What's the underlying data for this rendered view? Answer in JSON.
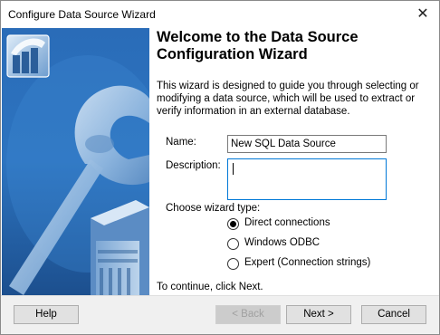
{
  "window": {
    "title": "Configure Data Source Wizard",
    "close_glyph": "✕"
  },
  "content": {
    "heading_line1": "Welcome to the Data Source",
    "heading_line2": "Configuration Wizard",
    "intro": "This wizard is designed to guide you through selecting or modifying a data source, which will be used to extract or verify information in an external database.",
    "name_label": "Name:",
    "name_value": "New SQL Data Source",
    "description_label": "Description:",
    "description_value": "",
    "wizard_type_label": "Choose wizard type:",
    "options": [
      {
        "label": "Direct connections",
        "selected": true
      },
      {
        "label": "Windows ODBC",
        "selected": false
      },
      {
        "label": "Expert (Connection strings)",
        "selected": false
      }
    ],
    "continue_text": "To continue, click Next."
  },
  "footer": {
    "help_label": "Help",
    "back_label": "< Back",
    "next_label": "Next >",
    "cancel_label": "Cancel"
  },
  "colors": {
    "banner_dark": "#1f5aa0",
    "banner_light": "#8ab4dc",
    "focus_border": "#0078d7"
  },
  "icons": [
    "database-wizard-logo-icon",
    "wrench-illustration",
    "server-tower-illustration",
    "close-icon"
  ]
}
